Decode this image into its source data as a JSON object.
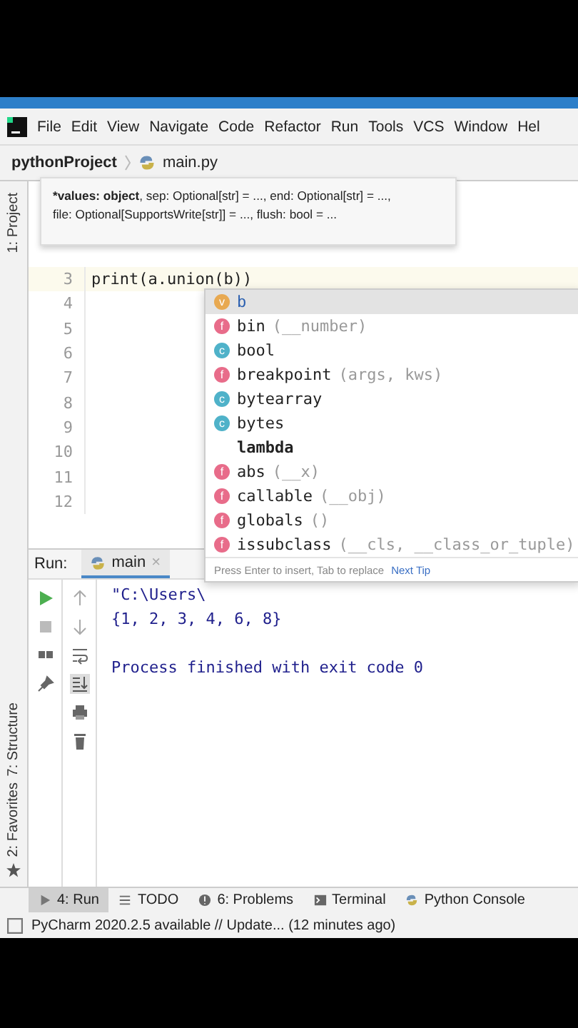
{
  "menu_bar": {
    "items": [
      "File",
      "Edit",
      "View",
      "Navigate",
      "Code",
      "Refactor",
      "Run",
      "Tools",
      "VCS",
      "Window",
      "Hel"
    ]
  },
  "breadcrumb": {
    "project": "pythonProject",
    "file": "main.py"
  },
  "side_tabs_left": [
    "1: Project",
    "7: Structure",
    "2: Favorites"
  ],
  "parameter_info": {
    "current_param": "*values: object",
    "line_1": ", sep: Optional[str] = ..., end: Optional[str] = ...,",
    "line_2": "file: Optional[SupportsWrite[str]] = ..., flush: bool = ..."
  },
  "editor": {
    "lines": [
      {
        "number": "3",
        "code": "print(a.union(b))",
        "current": true
      },
      {
        "number": "4",
        "current": false
      },
      {
        "number": "5",
        "current": false
      },
      {
        "number": "6",
        "current": false
      },
      {
        "number": "7",
        "current": false
      },
      {
        "number": "8",
        "current": false
      },
      {
        "number": "9",
        "current": false
      },
      {
        "number": "10",
        "current": false
      },
      {
        "number": "11",
        "current": false
      },
      {
        "number": "12",
        "current": false
      }
    ]
  },
  "completion": {
    "items": [
      {
        "kind": "variable",
        "badge": "v",
        "name": "b",
        "selected": true
      },
      {
        "kind": "function",
        "badge": "f",
        "name": "bin",
        "params": "(__number)",
        "selected": false
      },
      {
        "kind": "class",
        "badge": "c",
        "name": "bool",
        "selected": false
      },
      {
        "kind": "function",
        "badge": "f",
        "name": "breakpoint",
        "params": "(args, kws)",
        "selected": false
      },
      {
        "kind": "class",
        "badge": "c",
        "name": "bytearray",
        "selected": false
      },
      {
        "kind": "class",
        "badge": "c",
        "name": "bytes",
        "selected": false
      },
      {
        "kind": "keyword",
        "name": "lambda",
        "selected": false
      },
      {
        "kind": "function",
        "badge": "f",
        "name": "abs",
        "params": "(__x)",
        "selected": false
      },
      {
        "kind": "function",
        "badge": "f",
        "name": "callable",
        "params": "(__obj)",
        "selected": false
      },
      {
        "kind": "function",
        "badge": "f",
        "name": "globals",
        "params": "()",
        "selected": false
      },
      {
        "kind": "function",
        "badge": "f",
        "name": "issubclass",
        "params": "(__cls, __class_or_tuple)",
        "selected": false
      }
    ],
    "footer": "Press Enter to insert, Tab to replace",
    "tip_link": "Next Tip"
  },
  "run_panel": {
    "label": "Run:",
    "tab": "main",
    "close": "×",
    "console": [
      "\"C:\\Users\\",
      "{1, 2, 3, 4, 6, 8}"
    ],
    "exit_message": "Process finished with exit code 0"
  },
  "tool_tabs": [
    {
      "kind": "run",
      "label": "4: Run",
      "selected": true
    },
    {
      "kind": "todo",
      "label": "TODO",
      "selected": false
    },
    {
      "kind": "problems",
      "label": "6: Problems",
      "selected": false
    },
    {
      "kind": "terminal",
      "label": "Terminal",
      "selected": false
    },
    {
      "kind": "console",
      "label": "Python Console",
      "selected": false
    }
  ],
  "status_bar": {
    "message": "PyCharm 2020.2.5 available // Update... (12 minutes ago)"
  }
}
